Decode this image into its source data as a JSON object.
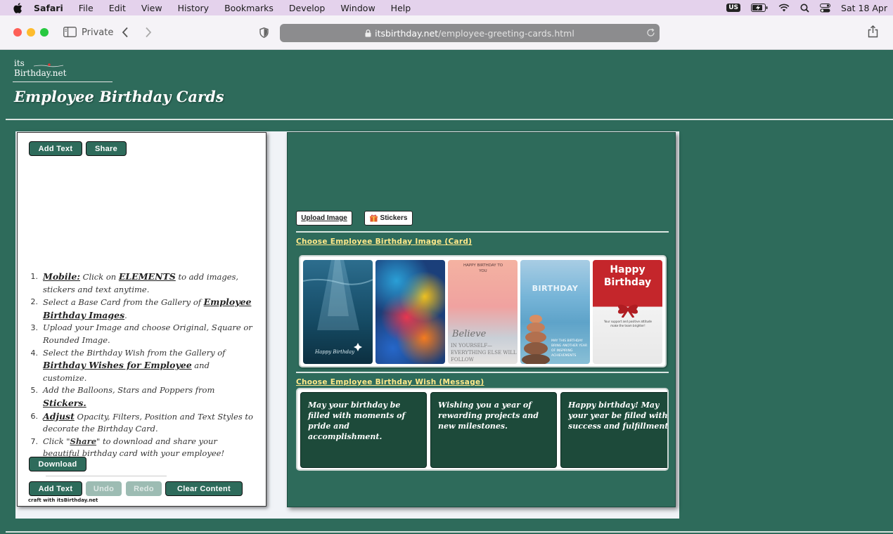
{
  "menubar": {
    "items": [
      "Safari",
      "File",
      "Edit",
      "View",
      "History",
      "Bookmarks",
      "Develop",
      "Window",
      "Help"
    ],
    "input_source": "US",
    "clock": "Sat 18 Apr"
  },
  "browser": {
    "private_label": "Private",
    "url_host": "itsbirthday.net",
    "url_path": "/employee-greeting-cards.html"
  },
  "site": {
    "logo_line1": "its",
    "logo_line2": "Birthday.net",
    "title": "Employee Birthday Cards"
  },
  "editor": {
    "add_text_label": "Add Text",
    "share_label": "Share",
    "download_label": "Download",
    "undo_label": "Undo",
    "redo_label": "Redo",
    "clear_label": "Clear Content",
    "craft_text": "craft with itsBirthday.net",
    "instructions": {
      "i1_key": "Mobile:",
      "i1_a": " Click on ",
      "i1_key2": "ELEMENTS",
      "i1_b": " to add images, stickers and text anytime.",
      "i2_a": "Select a Base Card from the Gallery of ",
      "i2_key": "Employee Birthday Images",
      "i2_b": ".",
      "i3": "Upload your Image and choose Original, Square or Rounded Image.",
      "i4_a": "Select the Birthday Wish from the Gallery of ",
      "i4_key": "Birthday Wishes for Employee",
      "i4_b": " and customize.",
      "i5_a": "Add the Balloons, Stars and Poppers from ",
      "i5_key": "Stickers.",
      "i6_key": "Adjust",
      "i6_b": " Opacity, Filters, Position and Text Styles to decorate the Birthday Card.",
      "i7_a": "Click \"",
      "i7_key": "Share",
      "i7_b": "\" to download and share your beautiful birthday card with your employee!"
    }
  },
  "gallery": {
    "upload_label": "Upload Image",
    "stickers_label": "Stickers",
    "images_heading": "Choose Employee Birthday Image (Card)",
    "wishes_heading": "Choose Employee Birthday Wish (Message)",
    "cards": [
      {
        "caption": "Happy Birthday"
      },
      {
        "caption": ""
      },
      {
        "caption_top": "HAPPY BIRTHDAY TO YOU",
        "caption_script": "Believe",
        "caption_bottom": "IN YOURSELF— EVERYTHING ELSE WILL FOLLOW"
      },
      {
        "caption": "BIRTHDAY",
        "caption_small": "MAY THIS BIRTHDAY BRING ANOTHER YEAR OF INSPIRING ACHIEVEMENTS"
      },
      {
        "caption_line1": "Happy",
        "caption_line2": "Birthday",
        "caption_small": "Your support and positive attitude make the team brighter!"
      }
    ],
    "wishes": [
      "May your birthday be filled with moments of pride and accomplishment.",
      "Wishing you a year of rewarding projects and new milestones.",
      "Happy birthday! May your year be filled with success and fulfillment."
    ]
  },
  "colors": {
    "page_bg": "#2e6b5b",
    "button_bg": "#2e6b5b",
    "heading_yellow": "#ffe98a",
    "wish_bg": "#1d4a3a"
  }
}
